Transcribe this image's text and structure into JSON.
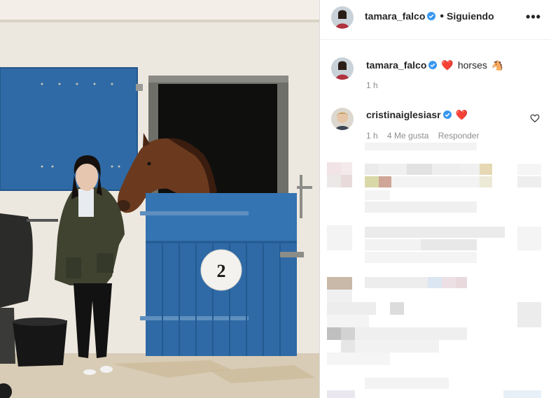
{
  "post": {
    "author": "tamara_falco",
    "follow_status": "Siguiendo",
    "more_label": "•••"
  },
  "caption": {
    "author": "tamara_falco",
    "emoji": "❤️",
    "text": "horses",
    "emoji_end": "🐴",
    "time": "1 h"
  },
  "comments": [
    {
      "author": "cristinaiglesiasr",
      "emoji": "❤️",
      "time": "1 h",
      "likes": "4 Me gusta",
      "reply": "Responder"
    }
  ],
  "photo": {
    "stall_number": "2"
  },
  "colors": {
    "verified": "#3897f0",
    "stall_blue": "#2f6aa6",
    "heart": "#ed4956"
  }
}
